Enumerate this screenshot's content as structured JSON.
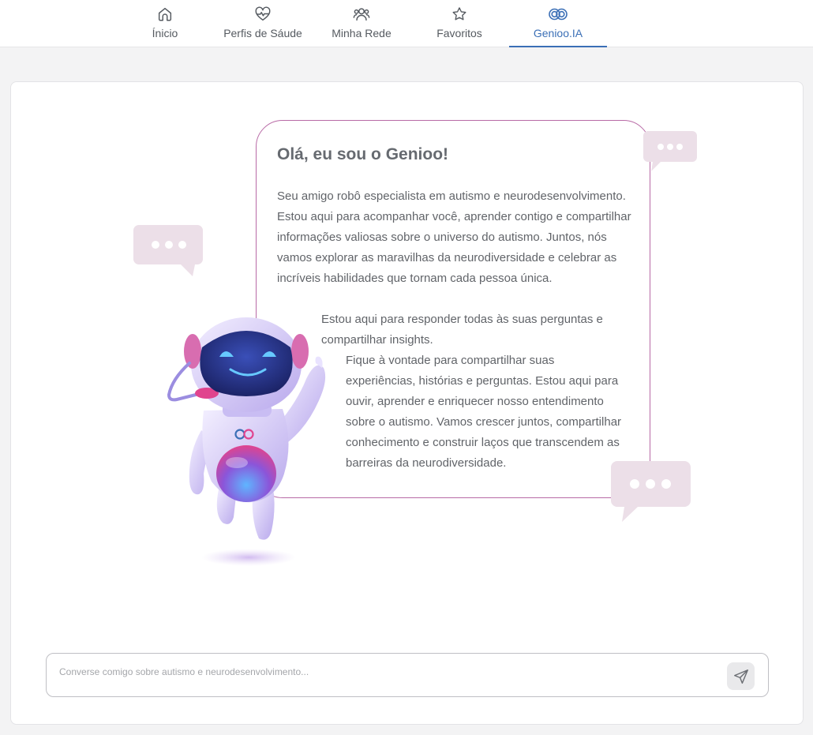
{
  "nav": {
    "items": [
      {
        "label": "Ínicio",
        "icon": "home-icon"
      },
      {
        "label": "Perfis de Sáude",
        "icon": "heart-pulse-icon"
      },
      {
        "label": "Minha Rede",
        "icon": "users-icon"
      },
      {
        "label": "Favoritos",
        "icon": "star-icon"
      },
      {
        "label": "Genioo.IA",
        "icon": "genioo-logo-icon",
        "active": true
      }
    ]
  },
  "colors": {
    "accent": "#3b6fb6",
    "bubble_border": "#b86aa6",
    "deco_bubble": "#ecdfe8"
  },
  "greeting": {
    "title": "Olá, eu sou o Genioo!",
    "paragraph_1": "Seu amigo robô especialista em autismo e neurodesenvolvimento. Estou aqui para acompanhar você, aprender contigo e compartilhar informações valiosas sobre o universo do autismo. Juntos, nós vamos explorar as maravilhas da neurodiversidade e celebrar as incríveis habilidades que tornam cada pessoa única.",
    "paragraph_2": "Estou aqui para responder todas às suas perguntas e compartilhar insights.",
    "paragraph_3": "Fique à vontade para compartilhar suas experiências, histórias e perguntas. Estou aqui para ouvir, aprender e enriquecer nosso entendimento sobre o autismo. Vamos crescer juntos, compartilhar conhecimento e construir laços que transcendem as barreiras da neurodiversidade."
  },
  "chat": {
    "placeholder": "Converse comigo sobre autismo e neurodesenvolvimento...",
    "value": "",
    "send_icon": "send-icon"
  }
}
